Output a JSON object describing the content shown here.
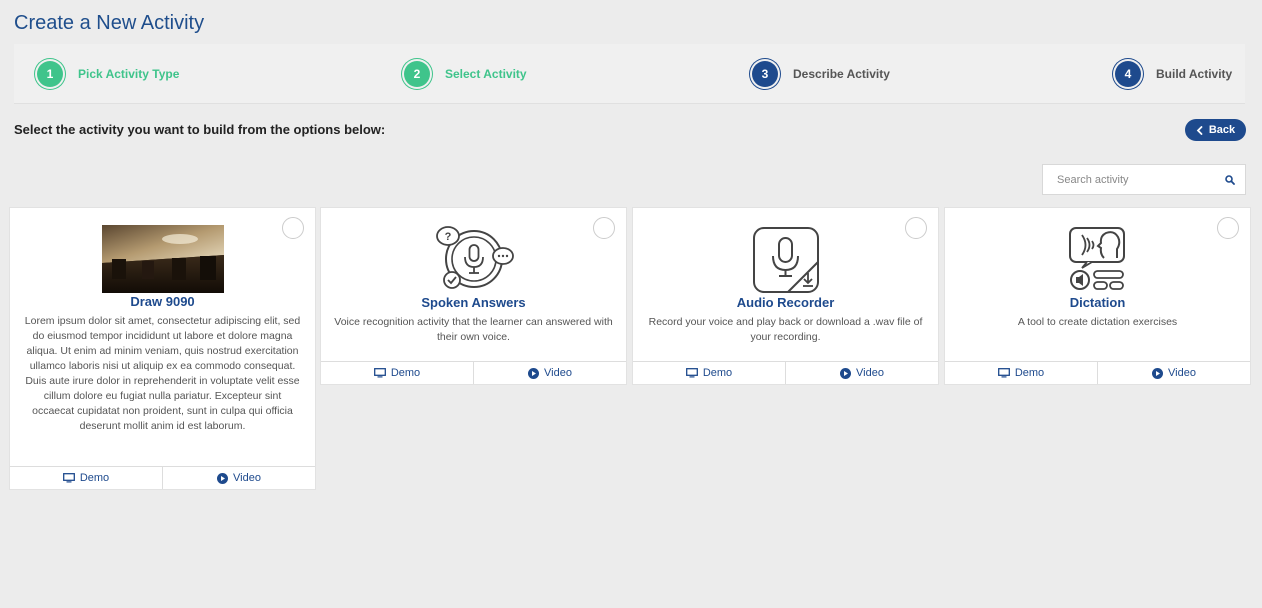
{
  "page": {
    "title": "Create a New Activity",
    "instruction": "Select the activity you want to build from the options below:"
  },
  "stepper": {
    "steps": [
      {
        "number": "1",
        "label": "Pick Activity Type",
        "status": "done"
      },
      {
        "number": "2",
        "label": "Select Activity",
        "status": "done"
      },
      {
        "number": "3",
        "label": "Describe Activity",
        "status": "todo"
      },
      {
        "number": "4",
        "label": "Build Activity",
        "status": "todo"
      }
    ]
  },
  "back_button": {
    "label": "Back",
    "icon": "chevron-left-icon"
  },
  "search": {
    "placeholder": "Search activity",
    "icon": "search-icon"
  },
  "colors": {
    "accent": "#1e4a8d",
    "done": "#3fc48b",
    "background": "#ececec"
  },
  "activities": [
    {
      "title": "Draw 9090",
      "description": "Lorem ipsum dolor sit amet, consectetur adipiscing elit, sed do eiusmod tempor incididunt ut labore et dolore magna aliqua. Ut enim ad minim veniam, quis nostrud exercitation ullamco laboris nisi ut aliquip ex ea commodo consequat. Duis aute irure dolor in reprehenderit in voluptate velit esse cillum dolore eu fugiat nulla pariatur. Excepteur sint occaecat cupidatat non proident, sunt in culpa qui officia deserunt mollit anim id est laborum.",
      "thumbnail": "photo-thumbnail",
      "demo_label": "Demo",
      "video_label": "Video"
    },
    {
      "title": "Spoken Answers",
      "description": "Voice recognition activity that the learner can answered with their own voice.",
      "thumbnail": "microphone-speech-icon",
      "demo_label": "Demo",
      "video_label": "Video"
    },
    {
      "title": "Audio Recorder",
      "description": "Record your voice and play back or download a .wav file of your recording.",
      "thumbnail": "microphone-download-icon",
      "demo_label": "Demo",
      "video_label": "Video"
    },
    {
      "title": "Dictation",
      "description": "A tool to create dictation exercises",
      "thumbnail": "speaking-head-icon",
      "demo_label": "Demo",
      "video_label": "Video"
    }
  ]
}
